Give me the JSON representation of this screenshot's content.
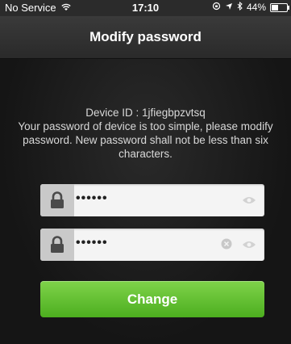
{
  "status_bar": {
    "carrier": "No Service",
    "time": "17:10",
    "battery": "44%",
    "battery_level": 0.44
  },
  "header": {
    "title": "Modify password"
  },
  "info": {
    "device_id_line": "Device ID : 1jfiegbpzvtsq",
    "message": "Your password of device is too simple, please modify password. New password shall not be less than six characters."
  },
  "fields": [
    {
      "value": "••••••",
      "icons": [
        "lock-icon",
        "eye-icon"
      ]
    },
    {
      "value": "••••••",
      "icons": [
        "lock-icon",
        "clear-icon",
        "eye-icon"
      ]
    }
  ],
  "actions": {
    "change_label": "Change"
  },
  "colors": {
    "accent": "#5cbd2a",
    "background": "#1c1c1c"
  }
}
